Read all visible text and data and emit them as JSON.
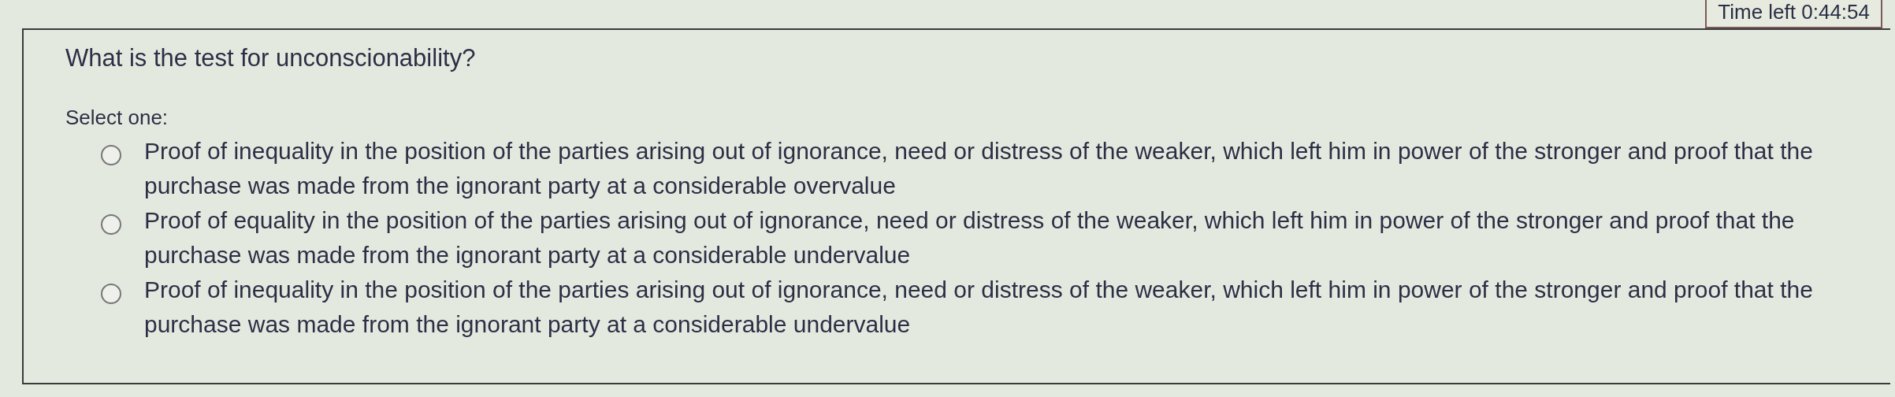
{
  "timer": "Time left 0:44:54",
  "question": "What is the test for unconscionability?",
  "prompt": "Select one:",
  "options": [
    {
      "label": "Proof of inequality in the position of the parties arising out of ignorance, need or distress of the weaker, which left him in power of the stronger and proof that the purchase was made from the ignorant party at a considerable overvalue",
      "selected": false
    },
    {
      "label": "Proof of equality in the position of the parties arising out of ignorance, need or distress of the weaker, which left him in power of the stronger and proof that the purchase was made from the ignorant party at a considerable undervalue",
      "selected": false
    },
    {
      "label": "Proof of inequality in the position of the parties arising out of ignorance, need or distress of the weaker, which left him in power of the stronger and proof that the purchase was made from the ignorant party at a considerable undervalue",
      "selected": false
    }
  ]
}
